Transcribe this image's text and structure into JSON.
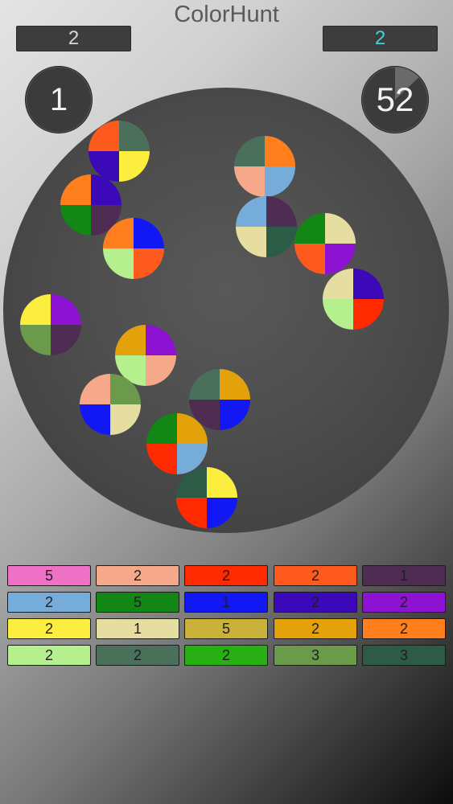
{
  "app": {
    "title": "ColorHunt"
  },
  "hud": {
    "score_left": "2",
    "score_right": "2",
    "level": "1",
    "timer": "52",
    "timer_remaining_fraction": 0.87
  },
  "colors": {
    "pink": "#ee71c6",
    "salmon": "#f6a98a",
    "red": "#ff2a00",
    "orange_red": "#ff5a1e",
    "dark_purple": "#4f2c52",
    "sky_blue": "#76acd9",
    "green": "#138716",
    "blue": "#1218f4",
    "indigo": "#3b09b8",
    "violet": "#8e12d2",
    "yellow": "#fbee3e",
    "cream": "#e6dda0",
    "mustard": "#c9b13a",
    "amber": "#e4a20a",
    "orange": "#ff7f1f",
    "light_green": "#b6f08e",
    "slate_green": "#4a6f5a",
    "bright_green": "#26b011",
    "moss": "#6c9a4c",
    "forest": "#2c5c45"
  },
  "balls": [
    {
      "quadrants": [
        "slate_green",
        "yellow",
        "indigo",
        "orange_red"
      ]
    },
    {
      "quadrants": [
        "indigo",
        "dark_purple",
        "green",
        "orange"
      ]
    },
    {
      "quadrants": [
        "blue",
        "orange_red",
        "light_green",
        "orange"
      ]
    },
    {
      "quadrants": [
        "orange",
        "sky_blue",
        "salmon",
        "slate_green"
      ]
    },
    {
      "quadrants": [
        "dark_purple",
        "forest",
        "cream",
        "sky_blue"
      ]
    },
    {
      "quadrants": [
        "cream",
        "violet",
        "orange_red",
        "green"
      ]
    },
    {
      "quadrants": [
        "indigo",
        "red",
        "light_green",
        "cream"
      ]
    },
    {
      "quadrants": [
        "violet",
        "dark_purple",
        "moss",
        "yellow"
      ]
    },
    {
      "quadrants": [
        "violet",
        "salmon",
        "light_green",
        "amber"
      ]
    },
    {
      "quadrants": [
        "moss",
        "cream",
        "blue",
        "salmon"
      ]
    },
    {
      "quadrants": [
        "amber",
        "blue",
        "dark_purple",
        "slate_green"
      ]
    },
    {
      "quadrants": [
        "amber",
        "sky_blue",
        "red",
        "green"
      ]
    },
    {
      "quadrants": [
        "yellow",
        "blue",
        "red",
        "forest"
      ]
    }
  ],
  "palette": [
    {
      "color": "pink",
      "count": "5"
    },
    {
      "color": "salmon",
      "count": "2"
    },
    {
      "color": "red",
      "count": "2"
    },
    {
      "color": "orange_red",
      "count": "2"
    },
    {
      "color": "dark_purple",
      "count": "1"
    },
    {
      "color": "sky_blue",
      "count": "2"
    },
    {
      "color": "green",
      "count": "5"
    },
    {
      "color": "blue",
      "count": "1"
    },
    {
      "color": "indigo",
      "count": "2"
    },
    {
      "color": "violet",
      "count": "2"
    },
    {
      "color": "yellow",
      "count": "2"
    },
    {
      "color": "cream",
      "count": "1"
    },
    {
      "color": "mustard",
      "count": "5"
    },
    {
      "color": "amber",
      "count": "2"
    },
    {
      "color": "orange",
      "count": "2"
    },
    {
      "color": "light_green",
      "count": "2"
    },
    {
      "color": "slate_green",
      "count": "2"
    },
    {
      "color": "bright_green",
      "count": "2"
    },
    {
      "color": "moss",
      "count": "3"
    },
    {
      "color": "forest",
      "count": "3"
    }
  ]
}
